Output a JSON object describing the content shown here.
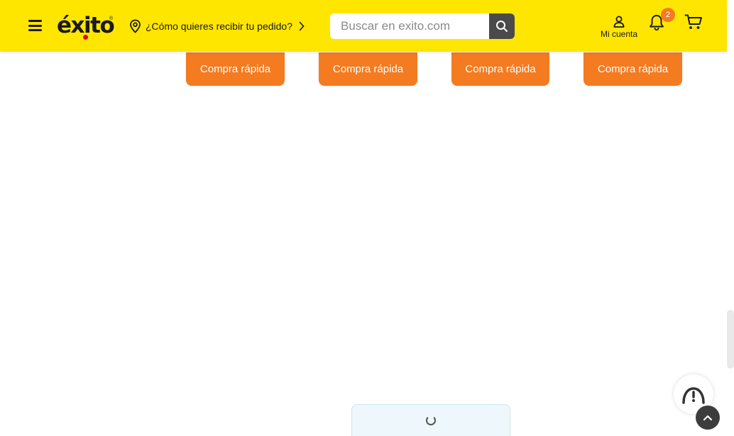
{
  "header": {
    "logo_text": "éxito",
    "logo_mark": "®",
    "delivery_prompt": "¿Cómo quieres recibir tu pedido?",
    "search_placeholder": "Buscar en exito.com",
    "account_label": "Mi cuenta",
    "notification_count": "2",
    "icons": [
      "menu-icon",
      "location-pin-icon",
      "chevron-right-icon",
      "search-icon",
      "user-icon",
      "bell-icon",
      "cart-icon"
    ]
  },
  "products": {
    "quick_buy_buttons": [
      "Compra rápida",
      "Compra rápida",
      "Compra rápida",
      "Compra rápida"
    ]
  },
  "floating": {
    "icons": [
      "help-chat-icon",
      "arrow-up-icon",
      "loading-spinner-icon"
    ]
  },
  "colors": {
    "brand_yellow": "#ffe600",
    "accent_orange": "#f47b20",
    "logo_red": "#e3001b",
    "dark": "#1a1a1a"
  }
}
